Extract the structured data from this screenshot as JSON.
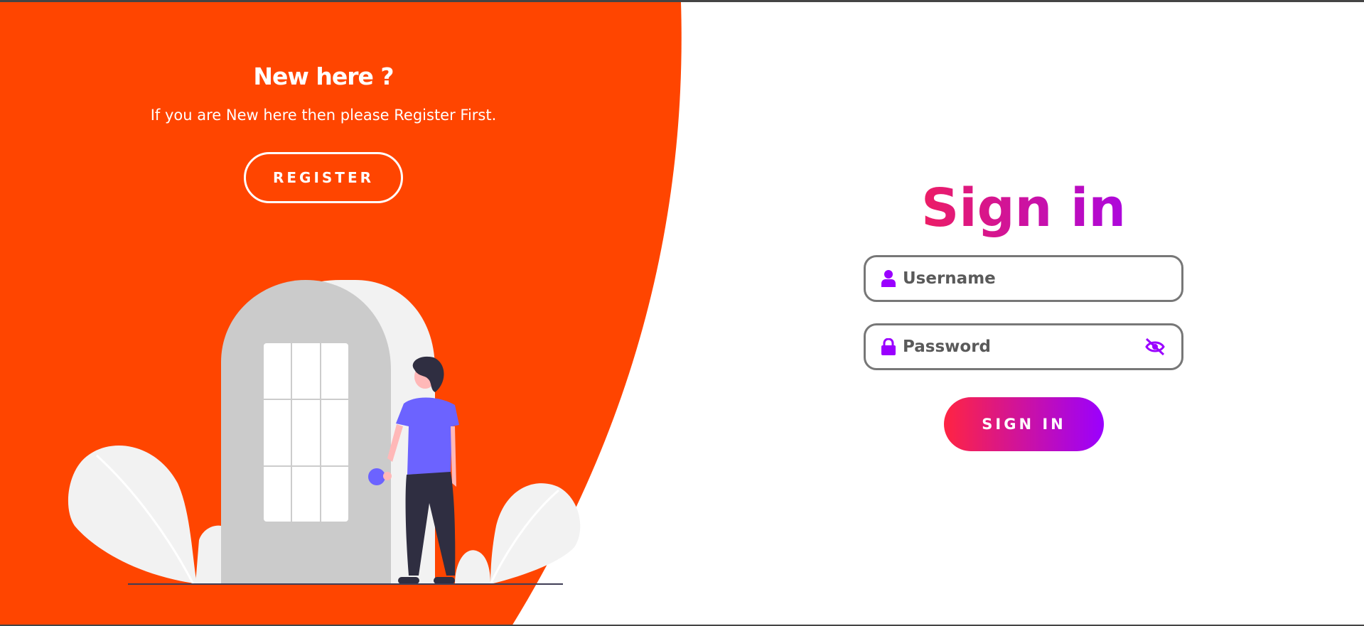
{
  "left_panel": {
    "title": "New here ?",
    "subtitle": "If you are New here then please Register First.",
    "register_label": "REGISTER"
  },
  "form": {
    "title": "Sign in",
    "username_placeholder": "Username",
    "password_placeholder": "Password",
    "signin_label": "SIGN IN"
  },
  "colors": {
    "panel_bg": "#ff4500",
    "gradient_start": "#ff2442",
    "gradient_end": "#9a00ff",
    "icon": "#9a00ff"
  }
}
